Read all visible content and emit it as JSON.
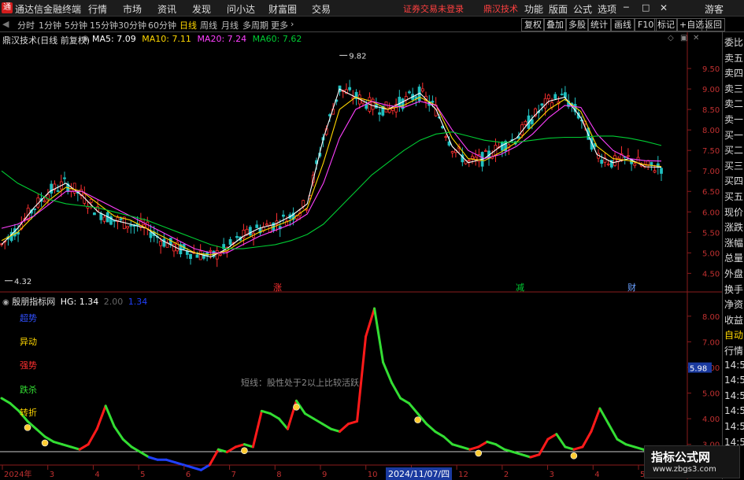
{
  "app": {
    "title": "通达信金融终端",
    "menu": [
      "行情",
      "市场",
      "资讯",
      "发现",
      "问小达",
      "财富圈",
      "交易"
    ],
    "warning": "证券交易未登录",
    "brand": "鼎汉技术",
    "right_menu": [
      "功能",
      "版面",
      "公式",
      "选项"
    ],
    "guest": "游客",
    "window_controls": [
      "minimize-icon",
      "restore-icon",
      "close-icon"
    ]
  },
  "toolbar": {
    "periods": [
      "分时",
      "1分钟",
      "5分钟",
      "15分钟",
      "30分钟",
      "60分钟",
      "日线",
      "周线",
      "月线",
      "多周期",
      "更多"
    ],
    "active_period": "日线",
    "right_buttons": [
      "复权",
      "叠加",
      "多股",
      "统计",
      "画线",
      "F10",
      "标记",
      "+自选",
      "返回"
    ]
  },
  "main_chart": {
    "stock_label": "鼎汉技术(日线 前复权)",
    "ma": [
      {
        "name": "MA5",
        "value": "7.09",
        "color": "#ffffff"
      },
      {
        "name": "MA10",
        "value": "7.11",
        "color": "#ffd700"
      },
      {
        "name": "MA20",
        "value": "7.24",
        "color": "#ff40ff"
      },
      {
        "name": "MA60",
        "value": "7.62",
        "color": "#00cc33"
      }
    ],
    "high_label": "9.82",
    "low_label": "4.32",
    "markers": [
      {
        "text": "涨",
        "color": "#ff3030"
      },
      {
        "text": "减",
        "color": "#00cc33"
      },
      {
        "text": "财",
        "color": "#6aa0ff"
      }
    ]
  },
  "chart_data": [
    {
      "type": "candlestick",
      "title": "鼎汉技术(日线 前复权)",
      "ylim": [
        4.2,
        10.0
      ],
      "y_ticks": [
        "9.50",
        "9.00",
        "8.50",
        "8.00",
        "7.50",
        "7.00",
        "6.50",
        "6.00",
        "5.50",
        "5.00",
        "4.50"
      ],
      "high": 9.82,
      "low": 4.32,
      "series": [
        {
          "name": "MA5",
          "color": "#ffffff",
          "values": [
            5.2,
            5.6,
            6.1,
            6.5,
            6.7,
            6.4,
            6.0,
            5.8,
            5.7,
            5.6,
            5.3,
            5.1,
            5.0,
            4.9,
            5.1,
            5.4,
            5.6,
            5.7,
            5.9,
            6.2,
            7.8,
            9.0,
            8.8,
            8.6,
            8.5,
            8.7,
            8.9,
            8.5,
            7.6,
            7.2,
            7.3,
            7.6,
            7.8,
            8.3,
            8.7,
            8.8,
            8.3,
            7.4,
            7.2,
            7.3,
            7.1,
            7.09
          ]
        },
        {
          "name": "MA10",
          "color": "#ffd700",
          "values": [
            5.3,
            5.5,
            5.9,
            6.3,
            6.6,
            6.5,
            6.2,
            5.9,
            5.8,
            5.6,
            5.4,
            5.2,
            5.0,
            4.95,
            5.05,
            5.3,
            5.5,
            5.65,
            5.8,
            6.1,
            7.2,
            8.5,
            8.8,
            8.7,
            8.5,
            8.6,
            8.8,
            8.6,
            7.8,
            7.3,
            7.25,
            7.45,
            7.7,
            8.1,
            8.5,
            8.75,
            8.45,
            7.6,
            7.3,
            7.25,
            7.15,
            7.11
          ]
        },
        {
          "name": "MA20",
          "color": "#ff40ff",
          "values": [
            5.6,
            5.7,
            5.9,
            6.2,
            6.5,
            6.5,
            6.3,
            6.1,
            5.9,
            5.7,
            5.5,
            5.3,
            5.1,
            5.0,
            5.0,
            5.2,
            5.4,
            5.55,
            5.7,
            5.95,
            6.7,
            7.8,
            8.5,
            8.7,
            8.6,
            8.55,
            8.7,
            8.6,
            8.0,
            7.5,
            7.3,
            7.4,
            7.6,
            7.9,
            8.3,
            8.6,
            8.55,
            7.9,
            7.5,
            7.3,
            7.25,
            7.24
          ]
        },
        {
          "name": "MA60",
          "color": "#00cc33",
          "values": [
            7.0,
            6.7,
            6.5,
            6.3,
            6.2,
            6.15,
            6.1,
            6.0,
            5.9,
            5.8,
            5.65,
            5.5,
            5.35,
            5.2,
            5.1,
            5.1,
            5.15,
            5.2,
            5.3,
            5.45,
            5.7,
            6.1,
            6.5,
            6.9,
            7.2,
            7.5,
            7.75,
            7.9,
            7.95,
            7.85,
            7.75,
            7.7,
            7.7,
            7.75,
            7.8,
            7.82,
            7.82,
            7.85,
            7.85,
            7.8,
            7.72,
            7.62
          ]
        }
      ]
    },
    {
      "type": "line",
      "title": "殷朋指标网",
      "ylim": [
        2.5,
        8.7
      ],
      "y_ticks": [
        "8.00",
        "7.00",
        "6.00",
        "5.00",
        "4.00",
        "3.00"
      ],
      "current_value": "5.98",
      "series": [
        {
          "name": "HG",
          "value_label": "1.34",
          "values": [
            4.8,
            4.6,
            4.3,
            3.9,
            3.6,
            3.3,
            3.1,
            3.0,
            2.9,
            2.8,
            3.0,
            3.6,
            4.5,
            3.7,
            3.2,
            2.9,
            2.7,
            2.5,
            2.4,
            2.4,
            2.3,
            2.2,
            2.1,
            2.0,
            2.2,
            2.8,
            2.7,
            2.9,
            3.0,
            2.9,
            4.3,
            4.2,
            4.0,
            3.6,
            4.7,
            4.2,
            4.0,
            3.8,
            3.6,
            3.5,
            3.8,
            3.9,
            7.2,
            8.3,
            6.2,
            5.4,
            4.8,
            4.6,
            4.2,
            3.8,
            3.5,
            3.3,
            3.0,
            2.9,
            2.8,
            2.9,
            3.1,
            3.0,
            2.8,
            2.7,
            2.6,
            2.5,
            2.6,
            3.2,
            3.4,
            2.9,
            2.8,
            2.9,
            3.5,
            4.4,
            3.8,
            3.2,
            3.0,
            2.9,
            2.8,
            2.6
          ]
        },
        {
          "name": "2.00",
          "values": []
        },
        {
          "name": "1.34",
          "values": []
        }
      ],
      "labels": [
        "超势",
        "异动",
        "强势",
        "跌杀",
        "转折"
      ],
      "annotation": "短线：股性处于2以上比较活跃"
    }
  ],
  "sub_chart": {
    "indicator_name": "殷朋指标网",
    "hg_label": "HG: 1.34",
    "line2_label": "2.00",
    "line3_label": "1.34",
    "annotation": "短线：股性处于2以上比较活跃",
    "side_labels": [
      {
        "text": "超势",
        "color": "#3050ff"
      },
      {
        "text": "异动",
        "color": "#ffd700"
      },
      {
        "text": "强势",
        "color": "#ff3030"
      },
      {
        "text": "跌杀",
        "color": "#33dd33"
      },
      {
        "text": "转折",
        "color": "#ffd700"
      }
    ]
  },
  "x_axis": {
    "labels": [
      "2024年",
      "3",
      "4",
      "5",
      "6",
      "7",
      "8",
      "9",
      "10",
      "11",
      "12",
      "2",
      "3",
      "4",
      "5"
    ],
    "cursor_date": "2024/11/07/四"
  },
  "right_panel": {
    "items": [
      "委比",
      "卖五",
      "卖四",
      "卖三",
      "卖二",
      "卖一",
      "买一",
      "买二",
      "买三",
      "买四",
      "买五",
      "现价",
      "涨跌",
      "涨幅",
      "总量",
      "外盘",
      "换手",
      "净资",
      "收益",
      "自动",
      "行情",
      "14:56",
      "14:56",
      "14:56",
      "14:56",
      "14:56",
      "14:56"
    ],
    "highlight": [
      "自动"
    ]
  },
  "watermark": {
    "line1": "指标公式网",
    "line2": "www.zbgs3.com"
  }
}
